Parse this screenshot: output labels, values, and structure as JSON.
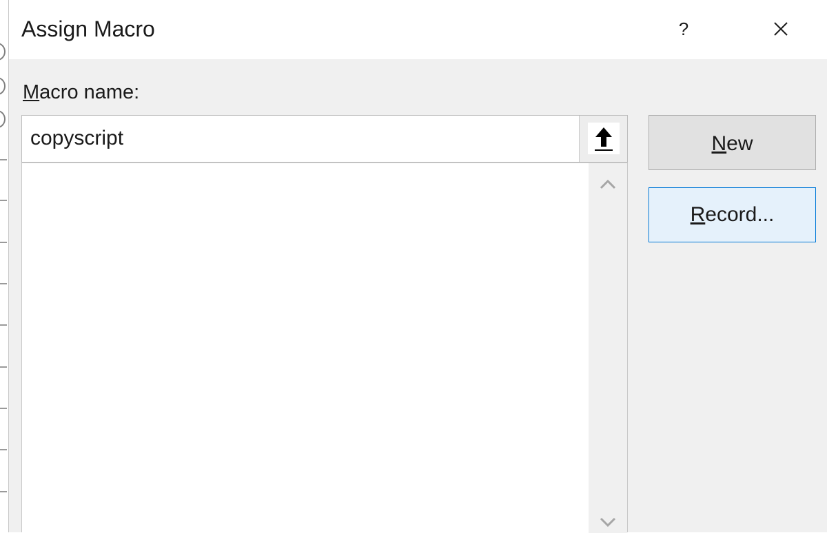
{
  "dialog": {
    "title": "Assign Macro",
    "help_label": "?",
    "macro_name_label": {
      "accel": "M",
      "rest": "acro name:"
    },
    "macro_name_value": "copyscript",
    "new_button": {
      "accel": "N",
      "rest": "ew"
    },
    "record_button": {
      "accel": "R",
      "rest": "ecord..."
    },
    "macro_list_items": []
  },
  "icons": {
    "close": "close-icon",
    "help": "help-icon",
    "collapse": "collapse-dialog-arrow-icon",
    "scroll_up": "chevron-up-icon",
    "scroll_down": "chevron-down-icon"
  },
  "colors": {
    "dialog_bg": "#f0f0f0",
    "title_bg": "#ffffff",
    "record_bg": "#e5f1fb",
    "record_border": "#0078d7"
  }
}
